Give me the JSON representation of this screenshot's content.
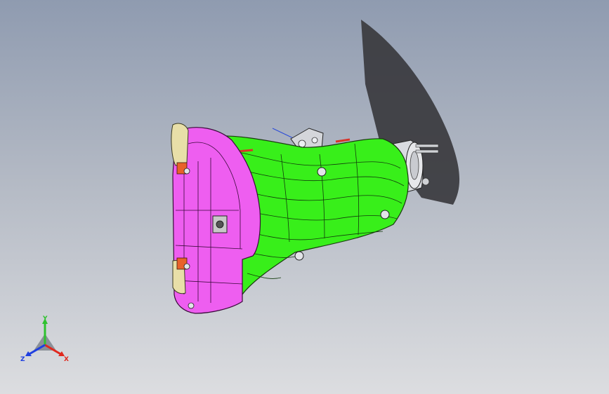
{
  "viewport": {
    "background_top": "#8f9bb0",
    "background_bottom": "#dcdde0"
  },
  "model": {
    "body_color": "#38ef1a",
    "shield_color": "#ee5ef0",
    "flange_color": "#e8dfa8",
    "accent_color": "#e8622a",
    "shadow_color": "#3a3a3e"
  },
  "triad": {
    "x_label": "X",
    "y_label": "Y",
    "z_label": "Z",
    "x_color": "#e0281e",
    "y_color": "#2ec22e",
    "z_color": "#1f3fe0"
  }
}
